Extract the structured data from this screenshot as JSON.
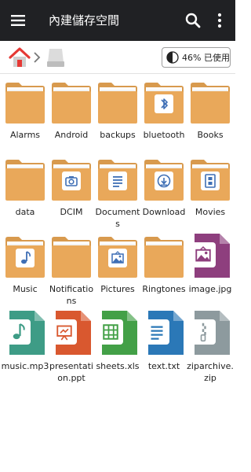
{
  "appbar": {
    "title": "內建儲存空間",
    "menu_icon": "hamburger-menu-icon",
    "search_icon": "search-icon",
    "more_icon": "more-vert-icon"
  },
  "breadcrumb": {
    "home_icon": "home-icon",
    "drive_icon": "internal-storage-icon",
    "storage_used": "46% 已使用"
  },
  "colors": {
    "appbar": "#202124",
    "folder": "#E9A85A",
    "folder_dark": "#D89A4E",
    "image_file": "#8E3F7E",
    "audio_file": "#3E9C86",
    "ppt_file": "#D9582F",
    "xls_file": "#43A047",
    "txt_file": "#2B78B7",
    "zip_file": "#8D9A9E"
  },
  "items": [
    {
      "name": "Alarms",
      "kind": "folder",
      "badge": ""
    },
    {
      "name": "Android",
      "kind": "folder",
      "badge": ""
    },
    {
      "name": "backups",
      "kind": "folder",
      "badge": ""
    },
    {
      "name": "bluetooth",
      "kind": "folder",
      "badge": "bluetooth-icon"
    },
    {
      "name": "Books",
      "kind": "folder",
      "badge": ""
    },
    {
      "name": "data",
      "kind": "folder",
      "badge": ""
    },
    {
      "name": "DCIM",
      "kind": "folder",
      "badge": "camera-icon"
    },
    {
      "name": "Documents",
      "kind": "folder",
      "badge": "document-icon"
    },
    {
      "name": "Download",
      "kind": "folder",
      "badge": "download-icon"
    },
    {
      "name": "Movies",
      "kind": "folder",
      "badge": "film-icon"
    },
    {
      "name": "Music",
      "kind": "folder",
      "badge": "music-note-icon"
    },
    {
      "name": "Notifications",
      "kind": "folder",
      "badge": ""
    },
    {
      "name": "Pictures",
      "kind": "folder",
      "badge": "picture-icon"
    },
    {
      "name": "Ringtones",
      "kind": "folder",
      "badge": ""
    },
    {
      "name": "image.jpg",
      "kind": "image",
      "badge": "picture-icon"
    },
    {
      "name": "music.mp3",
      "kind": "audio",
      "badge": "music-note-icon"
    },
    {
      "name": "presentation.ppt",
      "kind": "ppt",
      "badge": "presentation-icon"
    },
    {
      "name": "sheets.xls",
      "kind": "xls",
      "badge": "spreadsheet-icon"
    },
    {
      "name": "text.txt",
      "kind": "txt",
      "badge": "text-lines-icon"
    },
    {
      "name": "ziparchive.zip",
      "kind": "zip",
      "badge": "zipper-icon"
    }
  ]
}
